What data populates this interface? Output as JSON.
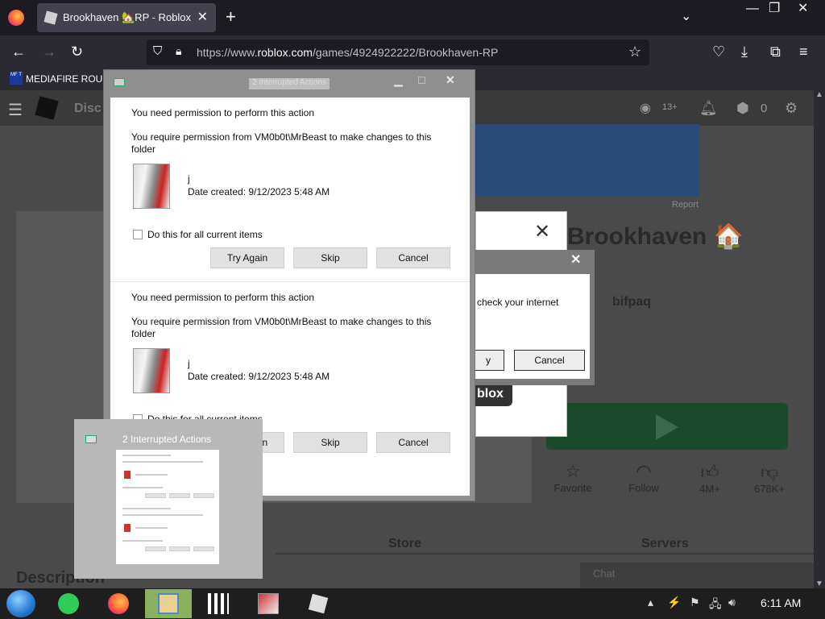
{
  "browser": {
    "tab_title": "Brookhaven 🏡RP - Roblox",
    "tab_close": "✕",
    "new_tab": "+",
    "url_prefix": "https://www.",
    "url_domain": "roblox.com",
    "url_path": "/games/4924922222/Brookhaven-RP",
    "bookmark_label": "MEDIAFIRE ROULE",
    "bookmark_icon_text": "MF T",
    "window_min": "—",
    "window_max": "❐",
    "window_close": "✕"
  },
  "roblox": {
    "nav_partial": "Disc",
    "age": "13+",
    "robux": "0",
    "report": "Report",
    "game_title": "Brookhaven 🏠",
    "creator_partial": "bifpaq",
    "favorite": "Favorite",
    "follow": "Follow",
    "likes": "4M+",
    "dislikes": "678K+",
    "store_tab": "Store",
    "servers_tab": "Servers",
    "description_heading": "Description",
    "chat_label": "Chat",
    "roblox_tag": "blox"
  },
  "error_dialog": {
    "message": "check your internet",
    "retry_partial": "y",
    "cancel": "Cancel"
  },
  "file_dialog": {
    "title": "2 Interrupted Actions",
    "items": [
      {
        "heading": "You need permission to perform this action",
        "detail": "You require permission from VM0b0t\\MrBeast to make changes to this folder",
        "folder_name": "j",
        "date_created": "Date created: 9/12/2023 5:48 AM",
        "checkbox_label": "Do this for all current items",
        "btn_try": "Try Again",
        "btn_skip": "Skip",
        "btn_cancel": "Cancel"
      },
      {
        "heading": "You need permission to perform this action",
        "detail": "You require permission from VM0b0t\\MrBeast to make changes to this folder",
        "folder_name": "j",
        "date_created": "Date created: 9/12/2023 5:48 AM",
        "checkbox_label": "Do this for all current items",
        "btn_try": "Try Again",
        "btn_skip": "Skip",
        "btn_cancel": "Cancel"
      }
    ]
  },
  "preview": {
    "title": "2 Interrupted Actions"
  },
  "taskbar": {
    "clock": "6:11 AM"
  }
}
